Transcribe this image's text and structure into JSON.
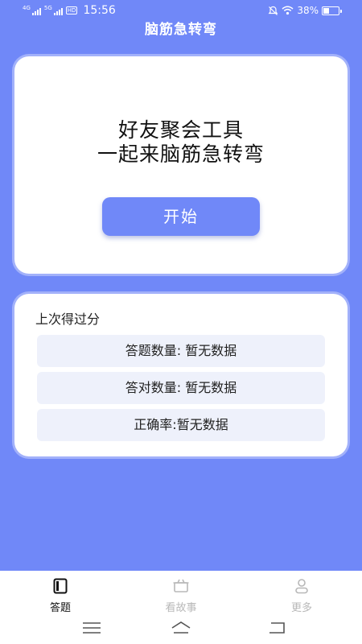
{
  "status_bar": {
    "network_1": "4G",
    "network_2": "5G",
    "hd_label": "HD",
    "time": "15:56",
    "battery": "38%",
    "battery_level": 0.38,
    "icons": [
      "signal-icon",
      "hd-icon",
      "mute-icon",
      "wifi-icon",
      "battery-icon"
    ]
  },
  "header": {
    "title": "脑筋急转弯"
  },
  "hero": {
    "line1": "好友聚会工具",
    "line2": "一起来脑筋急转弯",
    "start_label": "开始"
  },
  "score": {
    "title": "上次得过分",
    "rows": [
      "答题数量: 暂无数据",
      "答对数量: 暂无数据",
      "正确率:暂无数据"
    ]
  },
  "bottom_nav": {
    "items": [
      {
        "label": "答题",
        "icon": "quiz-book-icon",
        "active": true
      },
      {
        "label": "看故事",
        "icon": "story-box-icon",
        "active": false
      },
      {
        "label": "更多",
        "icon": "user-icon",
        "active": false
      }
    ]
  },
  "colors": {
    "background": "#7088f8",
    "card": "#ffffff",
    "primary_button": "#7088f8",
    "stat_row": "#eef1fb",
    "nav_active": "#111111",
    "nav_inactive": "#b8b8b8"
  }
}
